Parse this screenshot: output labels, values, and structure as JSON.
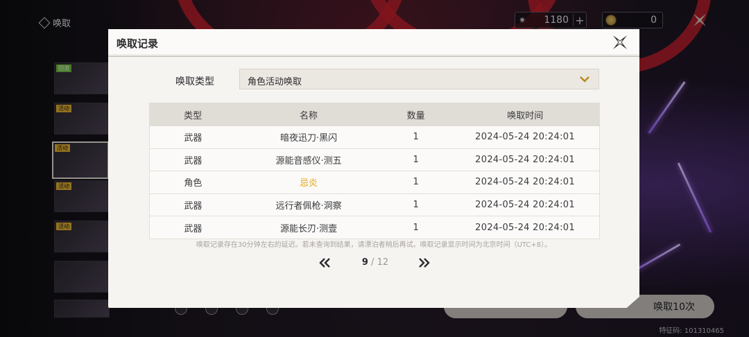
{
  "top_bar": {
    "title": "唤取",
    "currency_1": {
      "value": "1180",
      "icon": "star-icon"
    },
    "currency_2": {
      "value": "0",
      "icon": "coin-icon"
    }
  },
  "sidebar": {
    "tags": [
      "回流",
      "活动",
      "活动",
      "活动",
      "活动"
    ]
  },
  "bottom": {
    "convene_button": "唤取10次",
    "feature_code": "特征码: 101310465"
  },
  "dialog": {
    "title": "唤取记录",
    "type_label": "唤取类型",
    "type_value": "角色活动唤取",
    "table": {
      "headers": [
        "类型",
        "名称",
        "数量",
        "唤取时间"
      ],
      "rows": [
        {
          "type": "武器",
          "name": "暗夜迅刀·黑闪",
          "count": "1",
          "time": "2024-05-24 20:24:01",
          "highlight": false
        },
        {
          "type": "武器",
          "name": "源能音感仪·测五",
          "count": "1",
          "time": "2024-05-24 20:24:01",
          "highlight": false
        },
        {
          "type": "角色",
          "name": "忌炎",
          "count": "1",
          "time": "2024-05-24 20:24:01",
          "highlight": true
        },
        {
          "type": "武器",
          "name": "远行者佩枪·洞察",
          "count": "1",
          "time": "2024-05-24 20:24:01",
          "highlight": false
        },
        {
          "type": "武器",
          "name": "源能长刃·测壹",
          "count": "1",
          "time": "2024-05-24 20:24:01",
          "highlight": false
        }
      ]
    },
    "notice": "唤取记录存在30分钟左右的延迟。若未查询到结果，请漂泊者稍后再试。唤取记录显示时间为北京时间（UTC+8）。",
    "pager": {
      "current": "9",
      "separator": "/",
      "total": "12"
    }
  },
  "colors": {
    "highlight_gold": "#e0a614",
    "accent_red": "#c8202e",
    "dialog_bg": "#f6f4f1"
  }
}
